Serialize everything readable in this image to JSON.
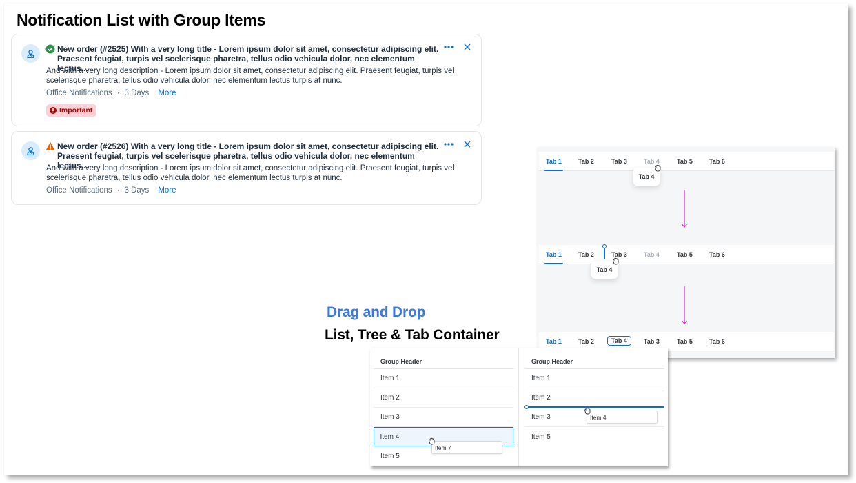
{
  "page": {
    "title": "Notification List with Group Items"
  },
  "notifications": [
    {
      "status": "success",
      "status_color": "#30914c",
      "title": "New order (#2525) With a very long title - Lorem ipsum dolor sit amet, consectetur adipiscing elit. Praesent feugiat, turpis vel scelerisque pharetra, tellus odio vehicula dolor, nec elementum lectus...",
      "description": "And with a very long description - Lorem ipsum dolor sit amet, consectetur adipiscing elit. Praesent feugiat, turpis vel scelerisque pharetra, tellus odio vehicula dolor, nec elementum lectus turpis at nunc.",
      "source": "Office Notifications",
      "separator": "·",
      "age": "3 Days",
      "more_label": "More",
      "badge": "Important"
    },
    {
      "status": "warning",
      "status_color": "#e76500",
      "title": "New order (#2526) With a very long title - Lorem ipsum dolor sit amet, consectetur adipiscing elit. Praesent feugiat, turpis vel scelerisque pharetra, tellus odio vehicula dolor, nec elementum lectus...",
      "description": "And with a very long description - Lorem ipsum dolor sit amet, consectetur adipiscing elit. Praesent feugiat, turpis vel scelerisque pharetra, tellus odio vehicula dolor, nec elementum lectus turpis at nunc.",
      "source": "Office Notifications",
      "separator": "·",
      "age": "3 Days",
      "more_label": "More"
    }
  ],
  "drag_drop": {
    "title": "Drag and Drop",
    "subtitle": "List, Tree & Tab Container",
    "accent_color": "#3b78e0",
    "arrow_color": "#e020d8"
  },
  "tab_states": [
    {
      "tabs": [
        "Tab 1",
        "Tab 2",
        "Tab 3",
        "Tab 4",
        "Tab 5",
        "Tab 6"
      ],
      "active": "Tab 1",
      "dragging": "Tab 4",
      "drag_ghost": "Tab 4"
    },
    {
      "tabs": [
        "Tab 1",
        "Tab 2",
        "Tab 3",
        "Tab 4",
        "Tab 5",
        "Tab 6"
      ],
      "active": "Tab 1",
      "dragging": "Tab 4",
      "drag_ghost": "Tab 4",
      "drop_between": [
        "Tab 2",
        "Tab 3"
      ]
    },
    {
      "tabs": [
        "Tab 1",
        "Tab 2",
        "Tab 4",
        "Tab 3",
        "Tab 5",
        "Tab 6"
      ],
      "active": "Tab 1",
      "focused": "Tab 4"
    }
  ],
  "lists": [
    {
      "header": "Group Header",
      "items": [
        "Item 1",
        "Item 2",
        "Item 3",
        "Item 4",
        "Item 5"
      ],
      "selected": "Item 4",
      "drag_ghost": "Item 7"
    },
    {
      "header": "Group Header",
      "items": [
        "Item 1",
        "Item 2",
        "Item 3",
        "Item 5"
      ],
      "drag_ghost": "Item 4",
      "drop_after": "Item 2"
    }
  ]
}
